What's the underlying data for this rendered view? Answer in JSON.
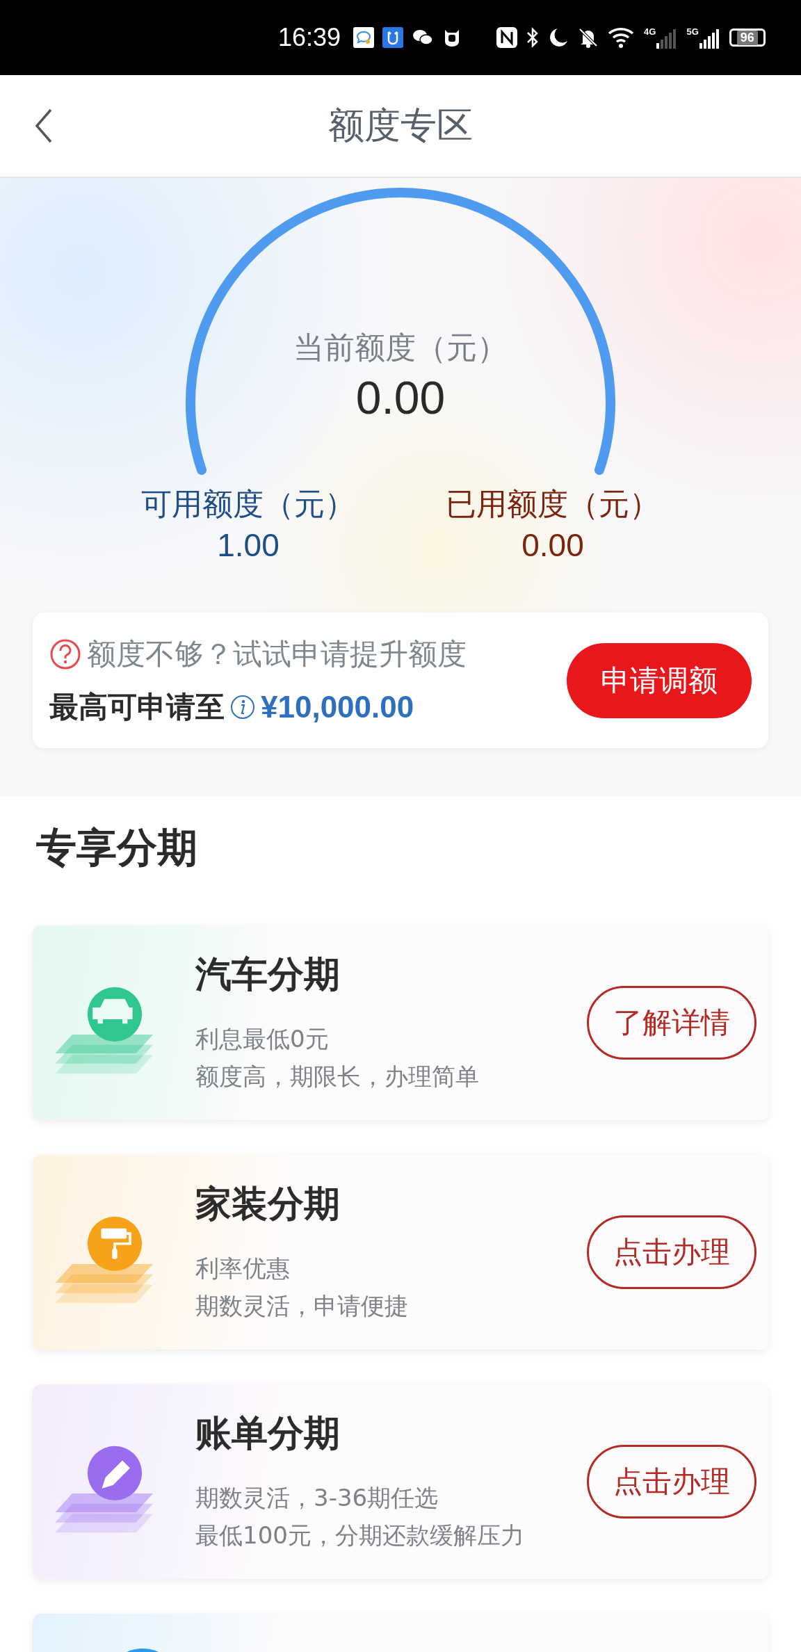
{
  "status_bar": {
    "time": "16:39",
    "signal_1": "4G",
    "signal_2": "5G",
    "battery": "96"
  },
  "header": {
    "title": "额度专区"
  },
  "gauge": {
    "label": "当前额度（元）",
    "value": "0.00"
  },
  "stats": [
    {
      "label": "可用额度（元）",
      "value": "1.00",
      "color": "#1f4d86"
    },
    {
      "label": "已用额度（元）",
      "value": "0.00",
      "color": "#7b2410"
    }
  ],
  "promo": {
    "hint": "额度不够？试试申请提升额度",
    "max_label": "最高可申请至",
    "max_value": "¥10,000.00",
    "button": "申请调额"
  },
  "section_title": "专享分期",
  "products": [
    {
      "kind": "car",
      "color": "#2fc68f",
      "title": "汽车分期",
      "line_1": "利息最低0元",
      "line_2": "额度高，期限长，办理简单",
      "button": "了解详情"
    },
    {
      "kind": "roller",
      "color": "#f7a21b",
      "title": "家装分期",
      "line_1": "利率优惠",
      "line_2": "期数灵活，申请便捷",
      "button": "点击办理"
    },
    {
      "kind": "pen",
      "color": "#9a6cf0",
      "title": "账单分期",
      "line_1": "期数灵活，3-36期任选",
      "line_2": "最低100元，分期还款缓解压力",
      "button": "点击办理"
    },
    {
      "kind": "partial",
      "color": "#2a9cf0"
    }
  ]
}
